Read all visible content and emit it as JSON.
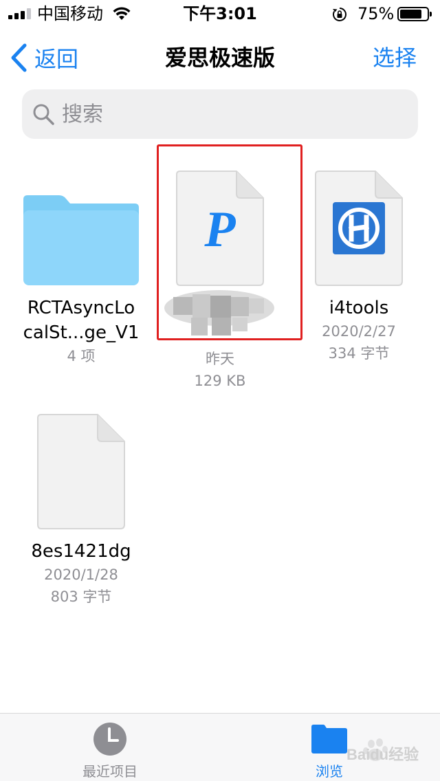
{
  "status_bar": {
    "carrier": "中国移动",
    "time": "下午3:01",
    "battery_percent": "75%",
    "battery_level": 0.75
  },
  "nav": {
    "back_label": "返回",
    "title": "爱思极速版",
    "select_label": "选择"
  },
  "search": {
    "placeholder": "搜索"
  },
  "items": [
    {
      "name_line1": "RCTAsyncLo",
      "name_line2": "calSt...ge_V1",
      "meta1": "4 项",
      "meta2": "",
      "type": "folder"
    },
    {
      "name_line1": "",
      "name_line2": "",
      "meta1": "昨天",
      "meta2": "129 KB",
      "type": "pdf-document",
      "icon_letter": "P"
    },
    {
      "name_line1": "i4tools",
      "name_line2": "",
      "meta1": "2020/2/27",
      "meta2": "334 字节",
      "type": "i4-document"
    },
    {
      "name_line1": "8es1421dg",
      "name_line2": "",
      "meta1": "2020/1/28",
      "meta2": "803 字节",
      "type": "blank-document"
    }
  ],
  "tabs": [
    {
      "label": "最近项目",
      "active": false
    },
    {
      "label": "浏览",
      "active": true
    }
  ],
  "colors": {
    "accent": "#1a82f0",
    "highlight": "#e02020",
    "tab_inactive": "#8e8e93"
  },
  "watermark": {
    "text": "Baidu经验"
  }
}
